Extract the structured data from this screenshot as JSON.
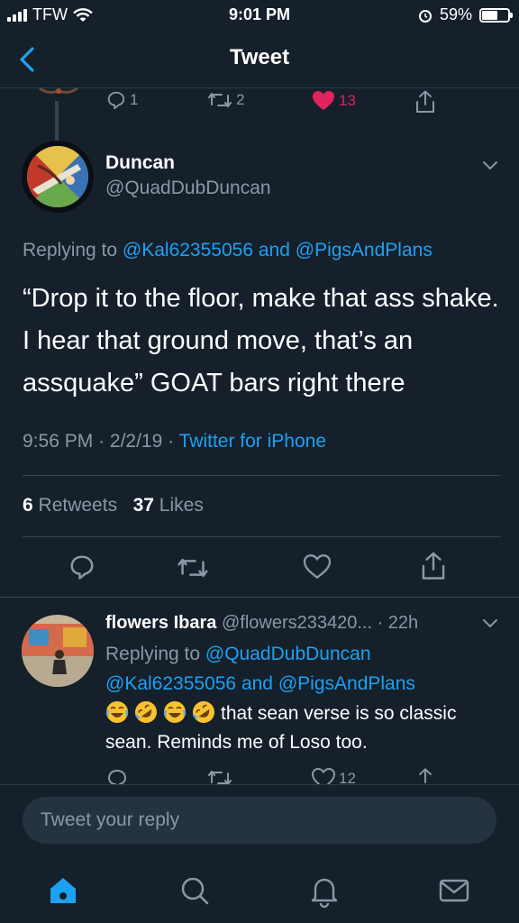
{
  "status_bar": {
    "carrier": "TFW",
    "time": "9:01 PM",
    "battery": "59%",
    "battery_level": 0.59
  },
  "nav": {
    "title": "Tweet"
  },
  "parent_actions": {
    "replies": "1",
    "retweets": "2",
    "likes": "13",
    "liked": true,
    "like_color": "#e0245e"
  },
  "main_tweet": {
    "name": "Duncan",
    "handle": "@QuadDubDuncan",
    "replying_prefix": "Replying to",
    "replying_to_1": "@Kal62355056",
    "replying_and": "and",
    "replying_to_2": "@PigsAndPlans",
    "text": "“Drop it to the floor, make that ass shake. I hear that ground move, that’s an assquake” GOAT bars right there",
    "time": "9:56 PM",
    "date": "2/2/19",
    "source": "Twitter for iPhone",
    "retweet_count": "6",
    "retweet_label": "Retweets",
    "like_count": "37",
    "like_label": "Likes"
  },
  "reply_tweet": {
    "name": "flowers Ibara",
    "handle": "@flowers233420...",
    "age": "· 22h",
    "replying_prefix": "Replying to",
    "replying_to_1": "@QuadDubDuncan",
    "replying_to_2": "@Kal62355056",
    "replying_and": "and",
    "replying_to_3": "@PigsAndPlans",
    "emojis": [
      "face-with-tears-of-joy",
      "rolling-on-floor-laughing",
      "face-with-tears-of-joy",
      "rolling-on-floor-laughing"
    ],
    "text": "that sean verse is so classic sean. Reminds me of Loso too.",
    "like_count": "12"
  },
  "composer": {
    "placeholder": "Tweet your reply"
  },
  "tabs": [
    "home-icon",
    "search-icon",
    "notifications-icon",
    "messages-icon"
  ],
  "colors": {
    "background": "#15202b",
    "accent": "#1da1f2",
    "secondary_text": "#8899a6",
    "divider": "#38444d"
  }
}
